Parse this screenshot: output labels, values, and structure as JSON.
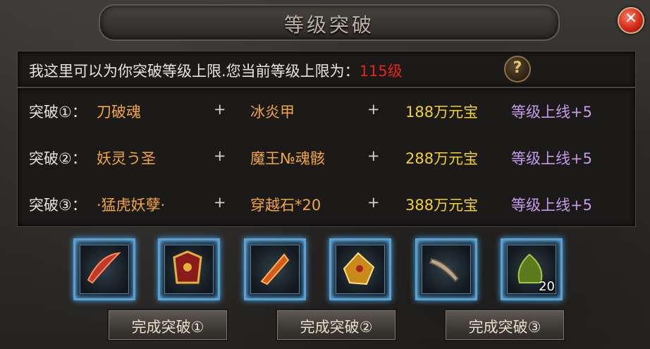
{
  "window": {
    "title": "等级突破",
    "close_icon": "close-icon"
  },
  "intro": {
    "text": "我这里可以为你突破等级上限.您当前等级上限为：",
    "level": "115级",
    "help_label": "?"
  },
  "rows": [
    {
      "label": "突破①：",
      "req1": "刀破魂",
      "plus1": "+",
      "req2": "冰炎甲",
      "plus2": "+",
      "cost": "188万元宝",
      "reward": "等级上线+5"
    },
    {
      "label": "突破②：",
      "req1": "妖灵う圣",
      "plus1": "+",
      "req2": "魔王№魂骸",
      "plus2": "+",
      "cost": "288万元宝",
      "reward": "等级上线+5"
    },
    {
      "label": "突破③：",
      "req1": "·猛虎妖孽·",
      "plus1": "+",
      "req2": "穿越石*20",
      "plus2": "+",
      "cost": "388万元宝",
      "reward": "等级上线+5"
    }
  ],
  "items": [
    {
      "icon": "blade-icon",
      "count": ""
    },
    {
      "icon": "armor-icon",
      "count": ""
    },
    {
      "icon": "flame-blade-icon",
      "count": ""
    },
    {
      "icon": "golden-armor-icon",
      "count": ""
    },
    {
      "icon": "bone-icon",
      "count": ""
    },
    {
      "icon": "crossing-stone-icon",
      "count": "20"
    }
  ],
  "buttons": [
    "完成突破①",
    "完成突破②",
    "完成突破③"
  ],
  "colors": {
    "level": "#e5241e",
    "requirement": "#f0a63c",
    "cost": "#f0d22e",
    "reward": "#c59ae8"
  }
}
